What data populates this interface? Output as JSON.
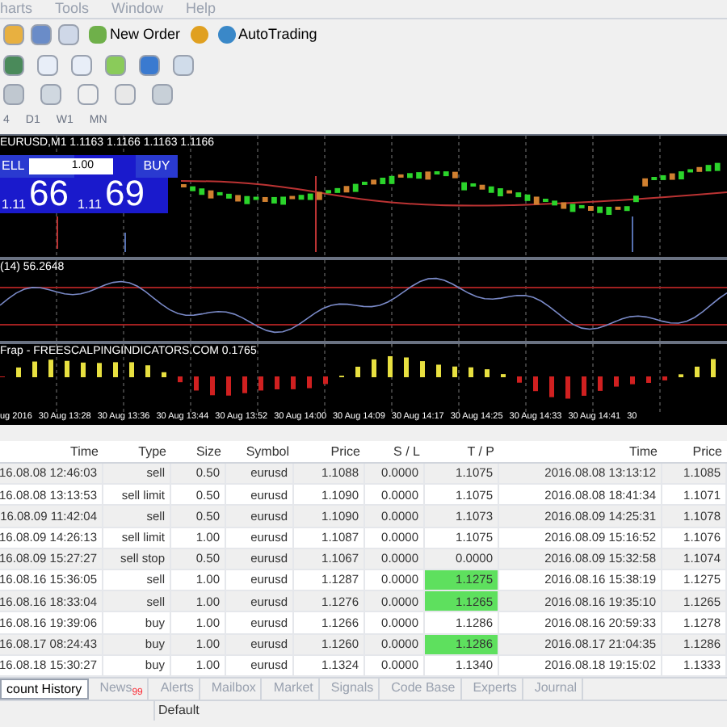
{
  "menu": [
    "harts",
    "Tools",
    "Window",
    "Help"
  ],
  "toolbar": {
    "new_order": "New Order",
    "auto_trading": "AutoTrading",
    "timeframes": [
      "4",
      "D1",
      "W1",
      "MN"
    ]
  },
  "chart": {
    "title": "EURUSD,M1  1.1163 1.1166 1.1163 1.1166",
    "trade_panel": {
      "sell": "ELL",
      "lot": "1.00",
      "buy": "BUY",
      "bid_prefix": "1.11",
      "bid": "66",
      "ask_prefix": "1.11",
      "ask": "69"
    },
    "indicator_1": "(14) 56.2648",
    "indicator_2": "Frap - FREESCALPINGINDICATORS.COM 0.1765",
    "time_axis": [
      "ug 2016",
      "30 Aug 13:28",
      "30 Aug 13:36",
      "30 Aug 13:44",
      "30 Aug 13:52",
      "30 Aug 14:00",
      "30 Aug 14:09",
      "30 Aug 14:17",
      "30 Aug 14:25",
      "30 Aug 14:33",
      "30 Aug 14:41",
      "30"
    ]
  },
  "table": {
    "columns": [
      "Time",
      "Type",
      "Size",
      "Symbol",
      "Price",
      "S / L",
      "T / P",
      "Time",
      "Price"
    ],
    "rows": [
      {
        "cells": [
          "16.08.08 12:46:03",
          "sell",
          "0.50",
          "eurusd",
          "1.1088",
          "0.0000",
          "1.1075",
          "2016.08.08 13:13:12",
          "1.1085"
        ],
        "tp_hit": false
      },
      {
        "cells": [
          "16.08.08 13:13:53",
          "sell limit",
          "0.50",
          "eurusd",
          "1.1090",
          "0.0000",
          "1.1075",
          "2016.08.08 18:41:34",
          "1.1071"
        ],
        "tp_hit": false
      },
      {
        "cells": [
          "16.08.09 11:42:04",
          "sell",
          "0.50",
          "eurusd",
          "1.1090",
          "0.0000",
          "1.1073",
          "2016.08.09 14:25:31",
          "1.1078"
        ],
        "tp_hit": false
      },
      {
        "cells": [
          "16.08.09 14:26:13",
          "sell limit",
          "1.00",
          "eurusd",
          "1.1087",
          "0.0000",
          "1.1075",
          "2016.08.09 15:16:52",
          "1.1076"
        ],
        "tp_hit": false
      },
      {
        "cells": [
          "16.08.09 15:27:27",
          "sell stop",
          "0.50",
          "eurusd",
          "1.1067",
          "0.0000",
          "0.0000",
          "2016.08.09 15:32:58",
          "1.1074"
        ],
        "tp_hit": false
      },
      {
        "cells": [
          "16.08.16 15:36:05",
          "sell",
          "1.00",
          "eurusd",
          "1.1287",
          "0.0000",
          "1.1275",
          "2016.08.16 15:38:19",
          "1.1275"
        ],
        "tp_hit": true
      },
      {
        "cells": [
          "16.08.16 18:33:04",
          "sell",
          "1.00",
          "eurusd",
          "1.1276",
          "0.0000",
          "1.1265",
          "2016.08.16 19:35:10",
          "1.1265"
        ],
        "tp_hit": true
      },
      {
        "cells": [
          "16.08.16 19:39:06",
          "buy",
          "1.00",
          "eurusd",
          "1.1266",
          "0.0000",
          "1.1286",
          "2016.08.16 20:59:33",
          "1.1278"
        ],
        "tp_hit": false
      },
      {
        "cells": [
          "16.08.17 08:24:43",
          "buy",
          "1.00",
          "eurusd",
          "1.1260",
          "0.0000",
          "1.1286",
          "2016.08.17 21:04:35",
          "1.1286"
        ],
        "tp_hit": true
      },
      {
        "cells": [
          "16.08.18 15:30:27",
          "buy",
          "1.00",
          "eurusd",
          "1.1324",
          "0.0000",
          "1.1340",
          "2016.08.18 19:15:02",
          "1.1333"
        ],
        "tp_hit": false
      }
    ]
  },
  "tabs": [
    {
      "label": "count History",
      "selected": true
    },
    {
      "label": "News",
      "badge": "99",
      "selected": false
    },
    {
      "label": "Alerts",
      "selected": false
    },
    {
      "label": "Mailbox",
      "selected": false
    },
    {
      "label": "Market",
      "selected": false
    },
    {
      "label": "Signals",
      "selected": false
    },
    {
      "label": "Code Base",
      "selected": false
    },
    {
      "label": "Experts",
      "selected": false
    },
    {
      "label": "Journal",
      "selected": false
    }
  ],
  "status_bar": {
    "profile": "Default"
  }
}
